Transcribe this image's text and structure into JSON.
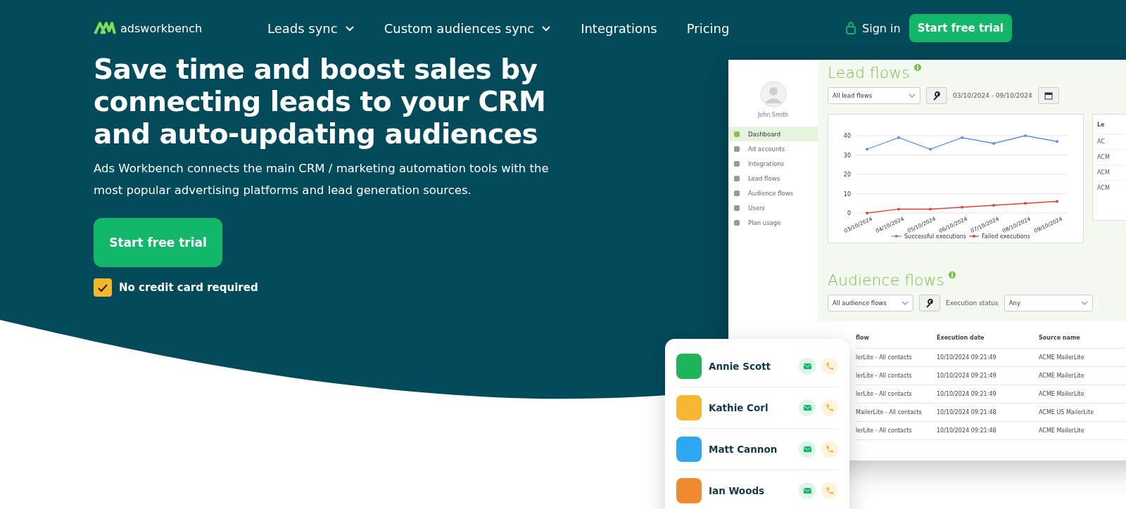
{
  "nav": {
    "logo_text": "adsworkbench",
    "items": [
      {
        "label": "Leads sync",
        "dropdown": true
      },
      {
        "label": "Custom audiences sync",
        "dropdown": true
      },
      {
        "label": "Integrations",
        "dropdown": false
      },
      {
        "label": "Pricing",
        "dropdown": false
      }
    ],
    "sign_in": "Sign in",
    "cta": "Start free trial"
  },
  "hero": {
    "title": "Save time and boost sales by connecting leads to your CRM and auto-updating audiences",
    "subtitle": "Ads Workbench connects the main CRM / marketing automation tools with the most popular advertising platforms and lead generation sources.",
    "cta": "Start free trial",
    "note": {
      "text": "No credit card required",
      "checked": true
    }
  },
  "dashboard": {
    "user": "John Smith",
    "menu": [
      {
        "label": "Dashboard",
        "selected": true
      },
      {
        "label": "Ad accounts",
        "selected": false
      },
      {
        "label": "Integrations",
        "selected": false
      },
      {
        "label": "Lead flows",
        "selected": false
      },
      {
        "label": "Audience flows",
        "selected": false
      },
      {
        "label": "Users",
        "selected": false
      },
      {
        "label": "Plan usage",
        "selected": false
      }
    ],
    "lead_flows": {
      "title": "Lead flows",
      "filter": "All lead flows",
      "date_range": "03/10/2024 - 09/10/2024",
      "chart_data": {
        "type": "line",
        "categories": [
          "03/10/2024",
          "04/10/2024",
          "05/10/2024",
          "06/10/2024",
          "07/10/2024",
          "08/10/2024",
          "09/10/2024"
        ],
        "yticks": [
          0,
          10,
          20,
          30,
          40
        ],
        "ylim": [
          0,
          40
        ],
        "grid": true,
        "legend": true,
        "series": [
          {
            "name": "Successful executions",
            "color": "#5b8def",
            "values": [
              33,
              39,
              33,
              39,
              36,
              40,
              37
            ]
          },
          {
            "name": "Failed executions",
            "color": "#d9482b",
            "values": [
              0,
              2,
              2,
              3,
              4,
              5,
              6
            ]
          }
        ]
      },
      "side_panel": {
        "header": "Le",
        "rows": [
          "AC",
          "ACM",
          "ACM",
          "ACM"
        ]
      }
    },
    "audience_flows": {
      "title": "Audience flows",
      "filter": "All audience flows",
      "status_label": "Execution status",
      "status_value": "Any",
      "columns": [
        "flow",
        "Execution date",
        "Source name"
      ],
      "rows": [
        [
          "lerLite - All contacts",
          "10/10/2024 09:21:49",
          "ACME MailerLite"
        ],
        [
          "lerLite - All contacts",
          "10/10/2024 09:21:49",
          "ACME MailerLite"
        ],
        [
          "lerLite - All contacts",
          "10/10/2024 09:21:49",
          "ACME MailerLite"
        ],
        [
          "MailerLite - All contacts",
          "10/10/2024 09:21:48",
          "ACME US MailerLite"
        ],
        [
          "lerLite - All contacts",
          "10/10/2024 09:21:48",
          "ACME MailerLite"
        ]
      ]
    }
  },
  "contacts": [
    {
      "name": "Annie Scott",
      "color": "#1fb45a"
    },
    {
      "name": "Kathie Corl",
      "color": "#f7b733"
    },
    {
      "name": "Matt Cannon",
      "color": "#2ea7f2"
    },
    {
      "name": "Ian Woods",
      "color": "#f08a2e"
    }
  ]
}
